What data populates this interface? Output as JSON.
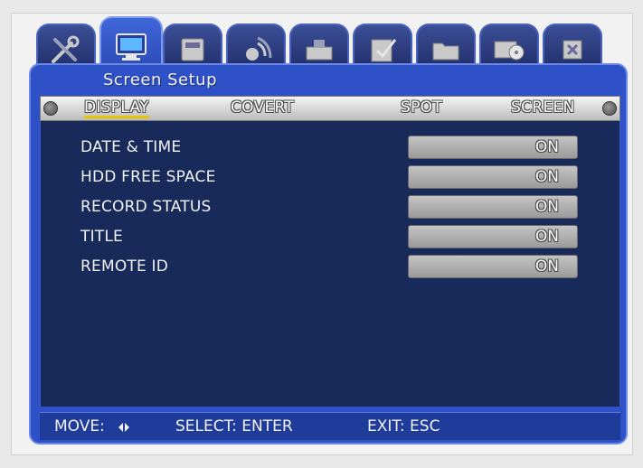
{
  "window": {
    "title": "Screen Setup"
  },
  "top_tabs": [
    {
      "icon": "tools-icon"
    },
    {
      "icon": "monitor-icon",
      "active": true
    },
    {
      "icon": "hdd-icon"
    },
    {
      "icon": "network-icon"
    },
    {
      "icon": "device-icon"
    },
    {
      "icon": "checklist-icon"
    },
    {
      "icon": "folder-icon"
    },
    {
      "icon": "backup-icon"
    },
    {
      "icon": "exit-icon"
    }
  ],
  "subtabs": {
    "display": "DISPLAY",
    "covert": "COVERT",
    "spot": "SPOT",
    "screen": "SCREEN"
  },
  "settings": [
    {
      "label": "DATE & TIME",
      "value": "ON"
    },
    {
      "label": "HDD FREE SPACE",
      "value": "ON"
    },
    {
      "label": "RECORD STATUS",
      "value": "ON"
    },
    {
      "label": "TITLE",
      "value": "ON"
    },
    {
      "label": "REMOTE ID",
      "value": "ON"
    }
  ],
  "status": {
    "move": "MOVE:",
    "select": "SELECT: ENTER",
    "exit": "EXIT: ESC"
  },
  "colors": {
    "accent": "#2f51c7",
    "content_bg": "#172a5a",
    "active_underline": "#e5c400"
  }
}
